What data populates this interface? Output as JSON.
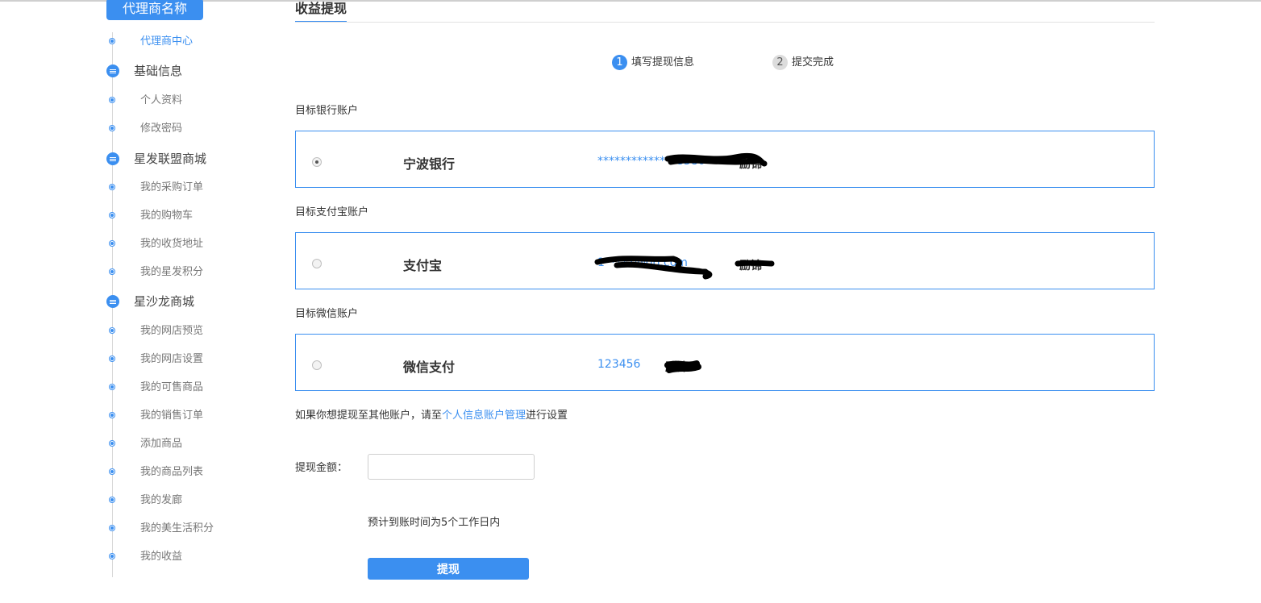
{
  "sidebar": {
    "agent_name": "代理商名称",
    "agent_center": "代理商中心",
    "sections": [
      {
        "title": "基础信息",
        "items": [
          "个人资料",
          "修改密码"
        ]
      },
      {
        "title": "星发联盟商城",
        "items": [
          "我的采购订单",
          "我的购物车",
          "我的收货地址",
          "我的星发积分"
        ]
      },
      {
        "title": "星沙龙商城",
        "items": [
          "我的网店预览",
          "我的网店设置",
          "我的可售商品",
          "我的销售订单",
          "添加商品",
          "我的商品列表",
          "我的发廊",
          "我的美生活积分",
          "我的收益"
        ]
      }
    ]
  },
  "main": {
    "title": "收益提现",
    "steps": [
      {
        "num": "1",
        "label": "填写提现信息"
      },
      {
        "num": "2",
        "label": "提交完成"
      }
    ],
    "accounts": [
      {
        "section_label": "目标银行账户",
        "name": "宁波银行",
        "account": "**************8380",
        "holder": "励锦",
        "selected": true
      },
      {
        "section_label": "目标支付宝账户",
        "name": "支付宝",
        "account": "1****7@qq.com",
        "holder": "励锦",
        "selected": false
      },
      {
        "section_label": "目标微信账户",
        "name": "微信支付",
        "account": "123456",
        "holder": "励锦",
        "selected": false
      }
    ],
    "hint": {
      "prefix": "如果你想提现至其他账户，请至",
      "link": "个人信息账户管理",
      "suffix": "进行设置"
    },
    "amount_label": "提现金额：",
    "amount_value": "",
    "eta": "预计到账时间为5个工作日内",
    "submit_label": "提现"
  },
  "colors": {
    "accent": "#3b8ff0",
    "text": "#333333",
    "muted": "#777777"
  }
}
